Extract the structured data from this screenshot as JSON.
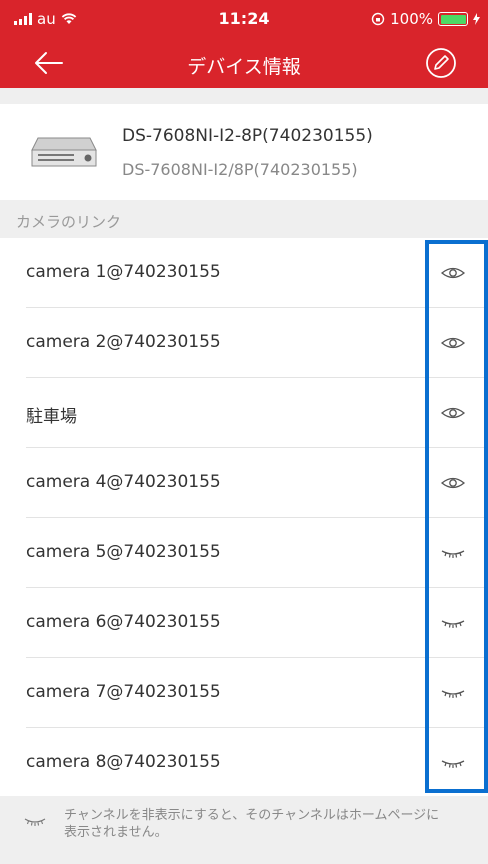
{
  "status_bar": {
    "carrier": "au",
    "time": "11:24",
    "battery": "100%"
  },
  "nav": {
    "title": "デバイス情報"
  },
  "device": {
    "name": "DS-7608NI-I2-8P(740230155)",
    "model": "DS-7608NI-I2/8P(740230155)"
  },
  "section": {
    "title": "カメラのリンク"
  },
  "cameras": [
    {
      "label": "camera 1@740230155",
      "icon": "eye-icon"
    },
    {
      "label": "camera 2@740230155",
      "icon": "eye-icon"
    },
    {
      "label": "駐車場",
      "icon": "eye-icon"
    },
    {
      "label": "camera 4@740230155",
      "icon": "eye-icon"
    },
    {
      "label": "camera 5@740230155",
      "icon": "eye-closed-icon"
    },
    {
      "label": "camera 6@740230155",
      "icon": "eye-closed-icon"
    },
    {
      "label": "camera 7@740230155",
      "icon": "eye-closed-icon"
    },
    {
      "label": "camera 8@740230155",
      "icon": "eye-closed-icon"
    }
  ],
  "footer": {
    "note": "チャンネルを非表示にすると、そのチャンネルはホームページに表示されません。"
  },
  "colors": {
    "header": "#d9242b",
    "highlight": "#0a6fd0",
    "background": "#efefef"
  }
}
